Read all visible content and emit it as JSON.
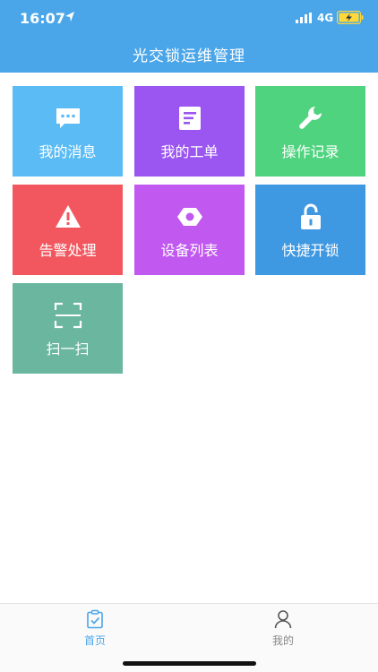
{
  "status": {
    "time": "16:07",
    "network": "4G",
    "location_icon": "location-arrow-icon",
    "signal_icon": "signal-bars-icon",
    "battery_icon": "battery-charging-icon"
  },
  "header": {
    "title": "光交锁运维管理",
    "background": "#4aa6e9"
  },
  "grid": {
    "tiles": [
      {
        "label": "我的消息",
        "icon": "message-icon",
        "color": "#5bbcf5"
      },
      {
        "label": "我的工单",
        "icon": "document-icon",
        "color": "#9b55f0"
      },
      {
        "label": "操作记录",
        "icon": "wrench-icon",
        "color": "#4fd37e"
      },
      {
        "label": "告警处理",
        "icon": "warning-icon",
        "color": "#f2575f"
      },
      {
        "label": "设备列表",
        "icon": "hex-nut-icon",
        "color": "#c159f0"
      },
      {
        "label": "快捷开锁",
        "icon": "padlock-icon",
        "color": "#3f98e2"
      },
      {
        "label": "扫一扫",
        "icon": "scan-frame-icon",
        "color": "#6ab69f"
      }
    ]
  },
  "tabbar": {
    "tabs": [
      {
        "label": "首页",
        "icon": "clipboard-check-icon",
        "active": true,
        "color": "#4aa6e9"
      },
      {
        "label": "我的",
        "icon": "user-icon",
        "active": false,
        "color": "#888888"
      }
    ]
  }
}
